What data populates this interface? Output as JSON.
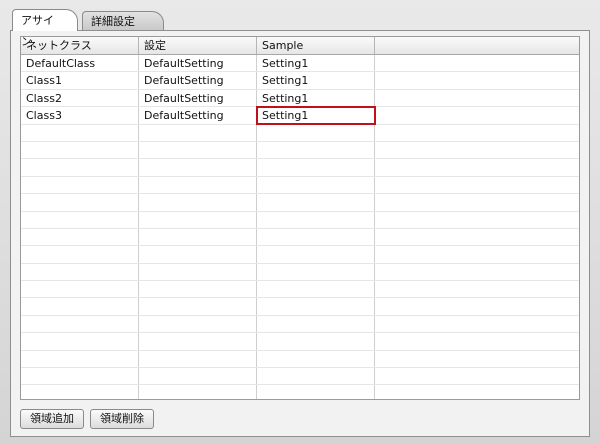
{
  "tabs": [
    {
      "label": "アサイン",
      "active": true
    },
    {
      "label": "詳細設定",
      "active": false
    }
  ],
  "table": {
    "columns": [
      "ネットクラス",
      "設定",
      "Sample",
      ""
    ],
    "rows": [
      [
        "DefaultClass",
        "DefaultSetting",
        "Setting1"
      ],
      [
        "Class1",
        "DefaultSetting",
        "Setting1"
      ],
      [
        "Class2",
        "DefaultSetting",
        "Setting1"
      ],
      [
        "Class3",
        "DefaultSetting",
        "Setting1"
      ]
    ],
    "selected_cell": {
      "row": 3,
      "col": 2
    }
  },
  "buttons": {
    "add_label": "領域追加",
    "delete_label": "領域削除"
  },
  "colors": {
    "selection_outline": "#c0101a"
  }
}
